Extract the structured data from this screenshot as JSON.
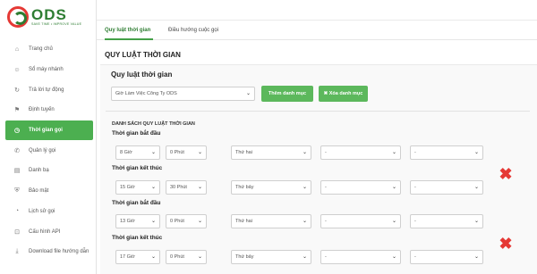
{
  "brand": {
    "name": "ODS",
    "tagline": "SAVE TIME • IMPROVE VALUE"
  },
  "sidebar": {
    "items": [
      {
        "label": "Trang chủ",
        "icon": "home-icon",
        "glyph": "⌂"
      },
      {
        "label": "Sổ máy nhánh",
        "icon": "users-icon",
        "glyph": "☺"
      },
      {
        "label": "Trả lời tự động",
        "icon": "refresh-icon",
        "glyph": "↻"
      },
      {
        "label": "Định tuyến",
        "icon": "signpost-icon",
        "glyph": "⚑"
      },
      {
        "label": "Thời gian gọi",
        "icon": "clock-icon",
        "glyph": "◷"
      },
      {
        "label": "Quản lý gọi",
        "icon": "phone-icon",
        "glyph": "✆"
      },
      {
        "label": "Danh bạ",
        "icon": "contacts-icon",
        "glyph": "▤"
      },
      {
        "label": "Bảo mật",
        "icon": "shield-icon",
        "glyph": "⛨"
      },
      {
        "label": "Lịch sử gọi",
        "icon": "history-icon",
        "glyph": "◔"
      },
      {
        "label": "Cấu hình API",
        "icon": "api-icon",
        "glyph": "⊡"
      },
      {
        "label": "Download file hướng dẫn",
        "icon": "download-icon",
        "glyph": "⤓"
      }
    ]
  },
  "tabs": {
    "rules": "Quy luật thời gian",
    "routing": "Điều hướng cuộc gọi"
  },
  "page": {
    "section_title": "QUY LUẬT THỜI GIAN",
    "panel_title": "Quy luật thời gian",
    "category_select": "Giờ Làm Việc Công Ty ODS",
    "add_button": "Thêm danh mục",
    "delete_button": "✖ Xóa danh mục",
    "list_title": "DANH SÁCH QUY LUẬT THỜI GIAN"
  },
  "rules": [
    {
      "start_label": "Thời gian bắt đầu",
      "start": {
        "hour": "8 Giờ",
        "minute": "0 Phút",
        "weekday": "Thứ hai",
        "day": "-",
        "month": "-"
      },
      "end_label": "Thời gian kết thúc",
      "end": {
        "hour": "15 Giờ",
        "minute": "30 Phút",
        "weekday": "Thứ bảy",
        "day": "-",
        "month": "-"
      }
    },
    {
      "start_label": "Thời gian bắt đầu",
      "start": {
        "hour": "13 Giờ",
        "minute": "0 Phút",
        "weekday": "Thứ hai",
        "day": "-",
        "month": "-"
      },
      "end_label": "Thời gian kết thúc",
      "end": {
        "hour": "17 Giờ",
        "minute": "0 Phút",
        "weekday": "Thứ bảy",
        "day": "-",
        "month": "-"
      }
    }
  ],
  "colors": {
    "accent": "#4caf50",
    "button": "#5cb85c",
    "delete": "#e53935",
    "brand_green": "#2e7d32",
    "brand_red": "#e53935"
  }
}
